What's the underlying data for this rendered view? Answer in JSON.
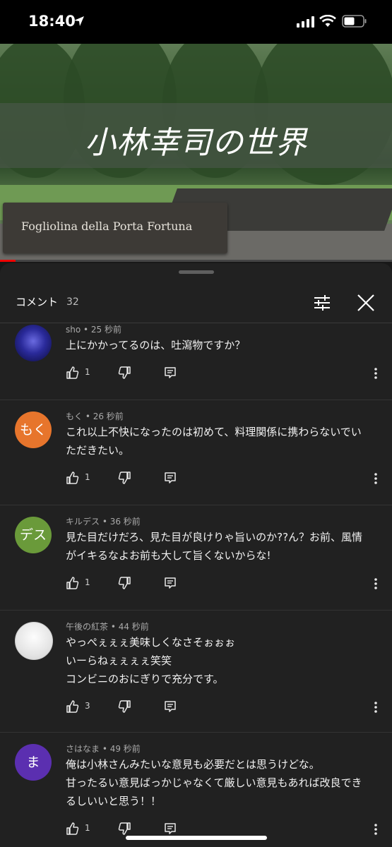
{
  "status_bar": {
    "time": "18:40"
  },
  "video": {
    "overlay_title": "小林幸司の世界",
    "sign_text": "Fogliolina della Porta Fortuna",
    "progress": 0.04
  },
  "comments_panel": {
    "title": "コメント",
    "count": "32"
  },
  "comments": [
    {
      "author_meta": "sho • 25 秒前",
      "avatar_text": "",
      "avatar_color": "#2a2a9a",
      "lines": [
        "上にかかってるのは、吐瀉物ですか？"
      ],
      "likes": "1"
    },
    {
      "author_meta": "もく • 26 秒前",
      "avatar_text": "もく",
      "avatar_color": "#e7752c",
      "lines": [
        "これ以上不快になったのは初めて、料理関係に携わらないでい",
        "ただきたい。"
      ],
      "likes": "1"
    },
    {
      "author_meta": "キルデス • 36 秒前",
      "avatar_text": "デス",
      "avatar_color": "#6a9a3a",
      "lines": [
        "見た目だけだろ、見た目が良けりゃ旨いのか??ん？お前、風情",
        "がイキるなよお前も大して旨くないからな!"
      ],
      "likes": "1"
    },
    {
      "author_meta": "午後の紅茶 • 44 秒前",
      "avatar_text": "",
      "avatar_color": "#f2f2f2",
      "lines": [
        "やっぺぇぇぇ美味しくなさそぉぉぉ",
        "いーらねぇぇぇぇ笑笑",
        "コンビニのおにぎりで充分です。"
      ],
      "likes": "3"
    },
    {
      "author_meta": "さはなま • 49 秒前",
      "avatar_text": "ま",
      "avatar_color": "#5b2fb0",
      "lines": [
        "俺は小林さんみたいな意見も必要だとは思うけどな。",
        "甘ったるい意見ばっかじゃなくて厳しい意見もあれば改良でき",
        "るしいいと思う！！"
      ],
      "likes": "1"
    }
  ]
}
